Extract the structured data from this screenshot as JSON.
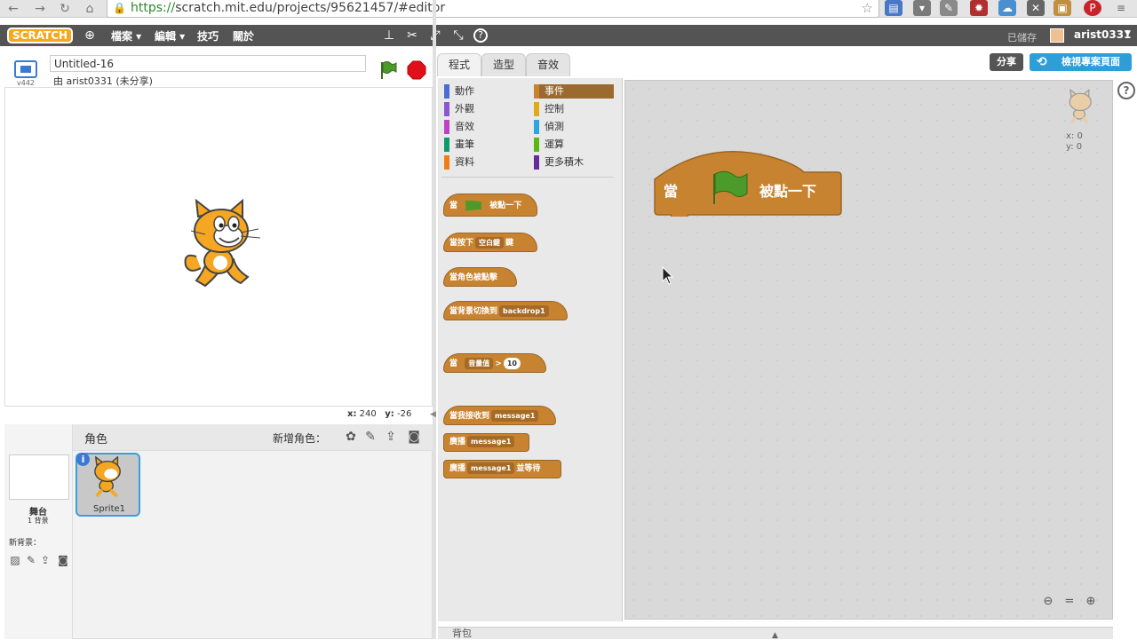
{
  "browser": {
    "url_scheme": "https://",
    "url_rest": "scratch.mit.edu/projects/95621457/#editor"
  },
  "menubar": {
    "logo": "SCRATCH",
    "items": [
      "檔案 ▾",
      "編輯 ▾",
      "技巧",
      "關於"
    ],
    "save_status": "已儲存",
    "username": "arist0331"
  },
  "stage_header": {
    "version": "v442",
    "project_title": "Untitled-16",
    "byline": "由 arist0331 (未分享)"
  },
  "stage": {
    "mouse_x_label": "x:",
    "mouse_x": "240",
    "mouse_y_label": "y:",
    "mouse_y": "-26"
  },
  "sprites": {
    "header": "角色",
    "new_sprite_label": "新增角色：",
    "stage_label": "舞台",
    "stage_backdrops": "1 背景",
    "new_backdrop_label": "新背景：",
    "sprite_name": "Sprite1"
  },
  "tabs": [
    "程式",
    "造型",
    "音效"
  ],
  "share_label": "分享",
  "view_project_label": "檢視專案頁面",
  "palette": {
    "categories_left": [
      "動作",
      "外觀",
      "音效",
      "畫筆",
      "資料"
    ],
    "categories_left_colors": [
      "#4a6cd4",
      "#8a55d7",
      "#bb42c3",
      "#0e9a6c",
      "#ee7d16"
    ],
    "categories_right": [
      "事件",
      "控制",
      "偵測",
      "運算",
      "更多積木"
    ],
    "categories_right_colors": [
      "#c88330",
      "#e1a91a",
      "#2ca5e2",
      "#5cb712",
      "#632d99"
    ],
    "selected": "事件",
    "blocks": {
      "when_flag_pre": "當",
      "when_flag_post": "被點一下",
      "when_key_pre": "當按下",
      "when_key_slot": "空白鍵",
      "when_key_post": "鍵",
      "when_sprite_clicked": "當角色被點擊",
      "when_backdrop_pre": "當背景切換到",
      "when_backdrop_slot": "backdrop1",
      "when_sensor_pre": "當",
      "when_sensor_slot": "音量值",
      "when_sensor_op": ">",
      "when_sensor_value": "10",
      "when_receive_pre": "當我接收到",
      "when_receive_slot": "message1",
      "broadcast_pre": "廣播",
      "broadcast_slot": "message1",
      "broadcast_wait_pre": "廣播",
      "broadcast_wait_slot": "message1",
      "broadcast_wait_post": "並等待"
    }
  },
  "script_area": {
    "block_pre": "當",
    "block_post": "被點一下",
    "sprite_x": "x: 0",
    "sprite_y": "y: 0"
  },
  "backpack_label": "背包",
  "colors": {
    "events": "#c88330",
    "menubar": "#545454",
    "accent": "#2e9ed8"
  }
}
